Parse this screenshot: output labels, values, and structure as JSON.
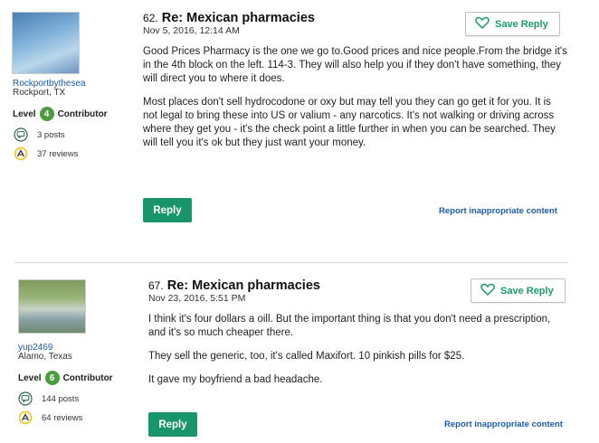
{
  "posts": [
    {
      "number": "62.",
      "title": "Re: Mexican pharmacies",
      "date": "Nov 5, 2016, 12:14 AM",
      "save_label": "Save Reply",
      "author": {
        "username": "Rockportbythesea",
        "location": "Rockport, TX",
        "level_label": "Level",
        "level": "4",
        "level_title": "Contributor",
        "posts": "3 posts",
        "reviews": "37 reviews"
      },
      "paragraphs": [
        "Good Prices Pharmacy is the one we go to.Good prices and nice people.From the bridge it's in the 4th block on the left. 114-3. They will also help you if they don't have something, they will direct you to where it does.",
        "Most places don't sell hydrocodone or oxy but may tell you they can go get it for you. It is not legal to bring these into US or valium - any narcotics. It's not walking or driving across where they get you - it's the check point a little further in when you can be searched. They will tell you it's ok but they just want your money."
      ],
      "reply_label": "Reply",
      "report_label": "Report inappropriate content"
    },
    {
      "number": "67.",
      "title": "Re: Mexican pharmacies",
      "date": "Nov 23, 2016, 5:51 PM",
      "save_label": "Save Reply",
      "author": {
        "username": "yup2469",
        "location": "Alamo, Texas",
        "level_label": "Level",
        "level": "6",
        "level_title": "Contributor",
        "posts": "144 posts",
        "reviews": "64 reviews"
      },
      "paragraphs": [
        "I think it's four dollars a oill. But the important thing is that you don't need a prescription, and it's so much cheaper there.",
        "They sell the generic, too, it's called Maxifort. 10 pinkish pills for $25.",
        "It gave my boyfriend a bad headache."
      ],
      "reply_label": "Reply",
      "report_label": "Report inappropriate content"
    }
  ],
  "icons": {
    "save": "heart-outline-icon",
    "posts": "speech-bubble-icon",
    "reviews": "review-badge-icon"
  },
  "colors": {
    "accent_green": "#18956a",
    "level_badge": "#4a9d3c",
    "link_blue": "#1a5ca8"
  }
}
